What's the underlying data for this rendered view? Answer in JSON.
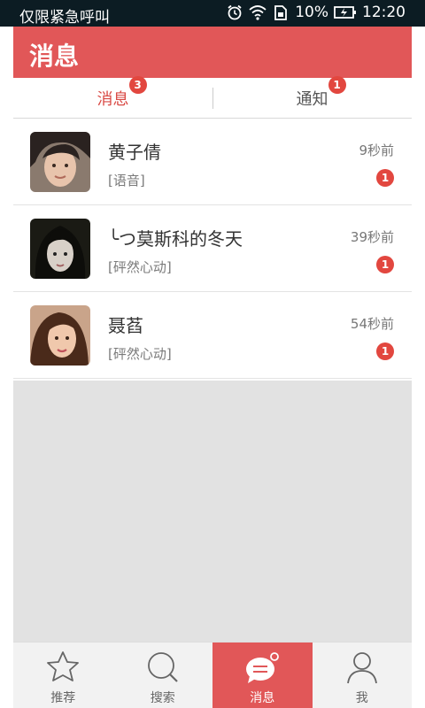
{
  "status_bar": {
    "carrier": "仅限紧急呼叫",
    "battery": "10%",
    "time": "12:20",
    "icons": [
      "alarm-icon",
      "wifi-icon",
      "sim-icon",
      "battery-icon"
    ]
  },
  "header": {
    "title": "消息"
  },
  "tabs": [
    {
      "label": "消息",
      "badge": "3",
      "active": true
    },
    {
      "label": "通知",
      "badge": "1",
      "active": false
    }
  ],
  "conversations": [
    {
      "name": "黄子倩",
      "preview": "[语音]",
      "time": "9秒前",
      "unread": "1"
    },
    {
      "name": "╰つ莫斯科的冬天",
      "preview": "[砰然心动]",
      "time": "39秒前",
      "unread": "1"
    },
    {
      "name": "聂萏",
      "preview": "[砰然心动]",
      "time": "54秒前",
      "unread": "1"
    }
  ],
  "bottom_nav": [
    {
      "label": "推荐",
      "icon": "star-icon",
      "active": false
    },
    {
      "label": "搜索",
      "icon": "search-icon",
      "active": false
    },
    {
      "label": "消息",
      "icon": "chat-bubble-icon",
      "active": true
    },
    {
      "label": "我",
      "icon": "person-icon",
      "active": false
    }
  ],
  "colors": {
    "accent": "#e15758",
    "badge": "#e2473f",
    "status_bar": "#0c1c23",
    "empty_background": "#e2e2e2"
  }
}
